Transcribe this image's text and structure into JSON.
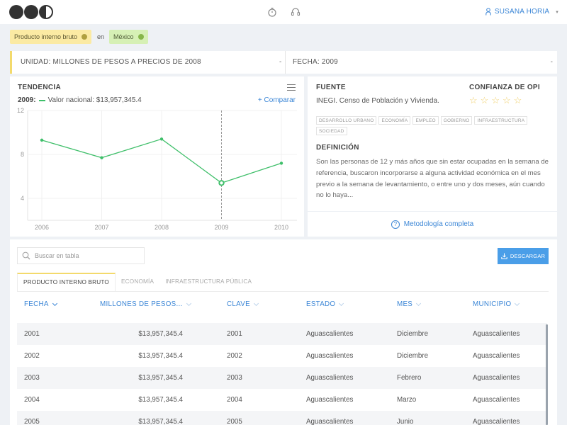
{
  "header": {
    "user_name": "SUSANA HORIA"
  },
  "filters": {
    "indicator": "Producto interno bruto",
    "connector": "en",
    "area": "México"
  },
  "unit_bar": {
    "unit": "UNIDAD: MILLONES DE PESOS A PRECIOS DE 2008",
    "unit_dash": "-",
    "date": "FECHA: 2009",
    "date_dash": "-"
  },
  "trend": {
    "title": "TENDENCIA",
    "year": "2009:",
    "value_label": "Valor nacional: $13,957,345.4",
    "compare": "+ Comparar"
  },
  "chart_data": {
    "type": "line",
    "x": [
      "2006",
      "2007",
      "2008",
      "2009",
      "2010"
    ],
    "series": [
      {
        "values": [
          9.3,
          7.7,
          9.4,
          5.4,
          7.2
        ]
      }
    ],
    "highlight_index": 3,
    "ylim": [
      2,
      12
    ],
    "yticks": [
      "12",
      "8",
      "4"
    ],
    "grid": true,
    "line_color": "#3fbf6a"
  },
  "source": {
    "title": "FUENTE",
    "text": "INEGI. Censo de Población y Vivienda.",
    "confidence_title": "CONFIANZA DE OPI",
    "confidence_stars": 5,
    "tags": [
      "DESARROLLO URBANO",
      "ECONOMÍA",
      "EMPLEO",
      "GOBIERNO",
      "INFRAESTRUCTURA",
      "SOCIEDAD"
    ],
    "definition_title": "DEFINICIÓN",
    "definition": "Son las personas de 12 y más años que sin estar ocupadas en la semana de referencia, buscaron incorporarse a alguna actividad económica en el mes previo a la semana de levantamiento, o entre uno y dos meses, aún cuando no lo haya...",
    "methodology": "Metodología completa"
  },
  "table": {
    "search_placeholder": "Buscar en tabla",
    "download": "DESCARGAR",
    "tabs": [
      "PRODUCTO INTERNO BRUTO",
      "ECONOMÍA",
      "INFRAESTRUCTURA PÚBLICA"
    ],
    "columns": [
      "FECHA",
      "MILLONES DE PESOS...",
      "CLAVE",
      "ESTADO",
      "MES",
      "MUNICIPIO"
    ],
    "rows": [
      [
        "2001",
        "$13,957,345.4",
        "2001",
        "Aguascalientes",
        "Diciembre",
        "Aguascalientes"
      ],
      [
        "2002",
        "$13,957,345.4",
        "2002",
        "Aguascalientes",
        "Diciembre",
        "Aguascalientes"
      ],
      [
        "2003",
        "$13,957,345.4",
        "2003",
        "Aguascalientes",
        "Febrero",
        "Aguascalientes"
      ],
      [
        "2004",
        "$13,957,345.4",
        "2004",
        "Aguascalientes",
        "Marzo",
        "Aguascalientes"
      ],
      [
        "2005",
        "$13,957,345.4",
        "2005",
        "Aguascalientes",
        "Junio",
        "Aguascalientes"
      ]
    ]
  },
  "colors": {
    "accent": "#3b86d6",
    "chip_yellow": "#fbeaa3",
    "chip_green": "#d6f0b5",
    "download_bg": "#4a9ee8"
  }
}
